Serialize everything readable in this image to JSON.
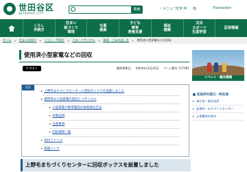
{
  "header": {
    "logo_ja": "世田谷区",
    "logo_en": "SETAGAYA CITY",
    "search_button": "検索",
    "util_menu": "・メニュー",
    "util_font": "文字:中",
    "util_color": "色:",
    "util_lang": "Translation"
  },
  "nav": {
    "items": [
      {
        "label": "くらし\n手続き"
      },
      {
        "label": "住まい\n街づくり\n環境"
      },
      {
        "label": "仕事\n産業"
      },
      {
        "label": "子ども\n教育\n若者支援"
      },
      {
        "label": "福祉\n健康"
      },
      {
        "label": "文化\nスポーツ\n生涯学習"
      },
      {
        "label": "区政情報"
      }
    ]
  },
  "breadcrumb": {
    "items": [
      "ホーム",
      "住まいを探す",
      "くらし・手続き",
      "ごみ・リサイクル",
      "資源・ごみの出し方"
    ],
    "current": "使用済小型家電などの回収"
  },
  "main": {
    "title": "使用済小型家電などの回収",
    "xpost": "X ポスト",
    "page_no": "ページ番号 127981",
    "updated": "令和4年12月20日",
    "updated_label": "最終更新日",
    "toc_label": "目次",
    "toc": [
      "上野毛まちづくりセンターに回収ボックスを設置しました",
      "使用済み小型家電の回収とリサイクル",
      "小型家電や携帯電話の再資源化方法",
      "対象品目",
      "注意事項",
      "回収場所一覧",
      "添付ファイル",
      "関連リンク"
    ],
    "section_title": "上野毛まちづくりセンターに回収ボックスを設置しました"
  },
  "side": {
    "banner_text": "イベント・観光情報",
    "head": "区役所の窓口・所在地",
    "links": [
      "本庁舎・総合支所",
      "出張所・まちづくりセンター",
      "上保健所の窓口"
    ]
  }
}
